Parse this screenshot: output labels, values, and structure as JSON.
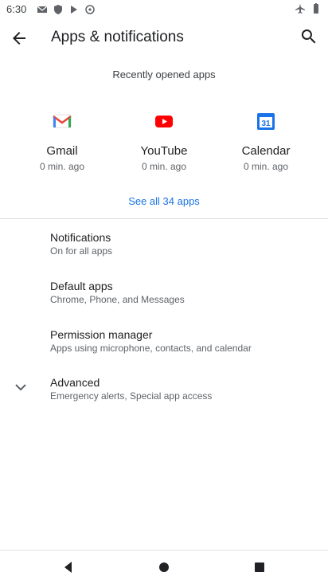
{
  "status": {
    "time": "6:30"
  },
  "toolbar": {
    "title": "Apps & notifications"
  },
  "recent": {
    "header": "Recently opened apps",
    "apps": [
      {
        "name": "Gmail",
        "time": "0 min. ago",
        "icon": "gmail-icon"
      },
      {
        "name": "YouTube",
        "time": "0 min. ago",
        "icon": "youtube-icon"
      },
      {
        "name": "Calendar",
        "time": "0 min. ago",
        "icon": "calendar-icon",
        "calendar_day": "31"
      }
    ],
    "see_all": "See all 34 apps"
  },
  "items": [
    {
      "label": "Notifications",
      "sub": "On for all apps"
    },
    {
      "label": "Default apps",
      "sub": "Chrome, Phone, and Messages"
    },
    {
      "label": "Permission manager",
      "sub": "Apps using microphone, contacts, and calendar"
    },
    {
      "label": "Advanced",
      "sub": "Emergency alerts, Special app access"
    }
  ],
  "colors": {
    "accent": "#1a73e8",
    "youtube": "#ff0000"
  }
}
